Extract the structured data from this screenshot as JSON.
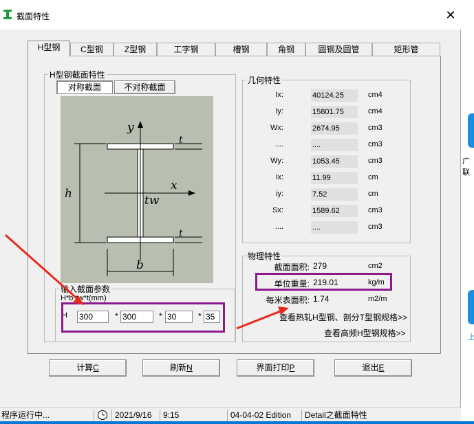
{
  "window": {
    "title": "截面特性",
    "close_glyph": "✕"
  },
  "tabs": [
    "H型钢",
    "C型钢",
    "Z型钢",
    "工字钢",
    "槽钢",
    "角钢",
    "圆钢及圆管",
    "矩形管"
  ],
  "h_section": {
    "group_label": "H型钢截面特性",
    "symmetric_button": "对称截面",
    "asymmetric_button": "不对称截面",
    "diagram_labels": {
      "y": "y",
      "x": "x",
      "tw": "tw",
      "t1": "t",
      "t2": "t",
      "h": "h",
      "b": "b"
    }
  },
  "geometry": {
    "label": "几何特性",
    "rows": [
      {
        "label": "Ix:",
        "value": "40124.25",
        "unit": "cm4"
      },
      {
        "label": "Iy:",
        "value": "15801.75",
        "unit": "cm4"
      },
      {
        "label": "Wx:",
        "value": "2674.95",
        "unit": "cm3"
      },
      {
        "label": "....",
        "value": "....",
        "unit": "cm3"
      },
      {
        "label": "Wy:",
        "value": "1053.45",
        "unit": "cm3"
      },
      {
        "label": "ix:",
        "value": "11.99",
        "unit": "cm"
      },
      {
        "label": "iy:",
        "value": "7.52",
        "unit": "cm"
      },
      {
        "label": "Sx:",
        "value": "1589.62",
        "unit": "cm3"
      },
      {
        "label": "....",
        "value": "....",
        "unit": "cm3"
      }
    ]
  },
  "physical": {
    "label": "物理特性",
    "area_label": "截面面积:",
    "area_value": "279",
    "area_unit": "cm2",
    "weight_label": "单位重量:",
    "weight_value": "219.01",
    "weight_unit": "kg/m",
    "surface_label": "每米表面积:",
    "surface_value": "1.74",
    "surface_unit": "m2/m",
    "link_hot_rolled": "查看热轧H型钢、剖分T型钢规格>>",
    "link_high_freq": "查看高频H型钢规格>>"
  },
  "input_params": {
    "label": "输入截面参数",
    "formula": "H*b*tw*t(mm)",
    "prefix": "H",
    "values": [
      "300",
      "300",
      "30",
      "35"
    ],
    "sep": "*"
  },
  "buttons": {
    "calc": "计算",
    "calc_key": "C",
    "refresh": "刷新",
    "refresh_key": "N",
    "print": "界面打印",
    "print_key": "P",
    "exit": "退出",
    "exit_key": "E"
  },
  "status": {
    "running": "程序运行中...",
    "date": "2021/9/16",
    "time": "9:15",
    "edition": "04-04-02 Edition",
    "detail": "Detail之截面特性"
  },
  "side": {
    "text1": "广联",
    "text2": "上"
  },
  "colors": {
    "highlight": "#8b1a8b",
    "arrow": "#e8291c",
    "diagram_bg": "#b8bfb0"
  }
}
